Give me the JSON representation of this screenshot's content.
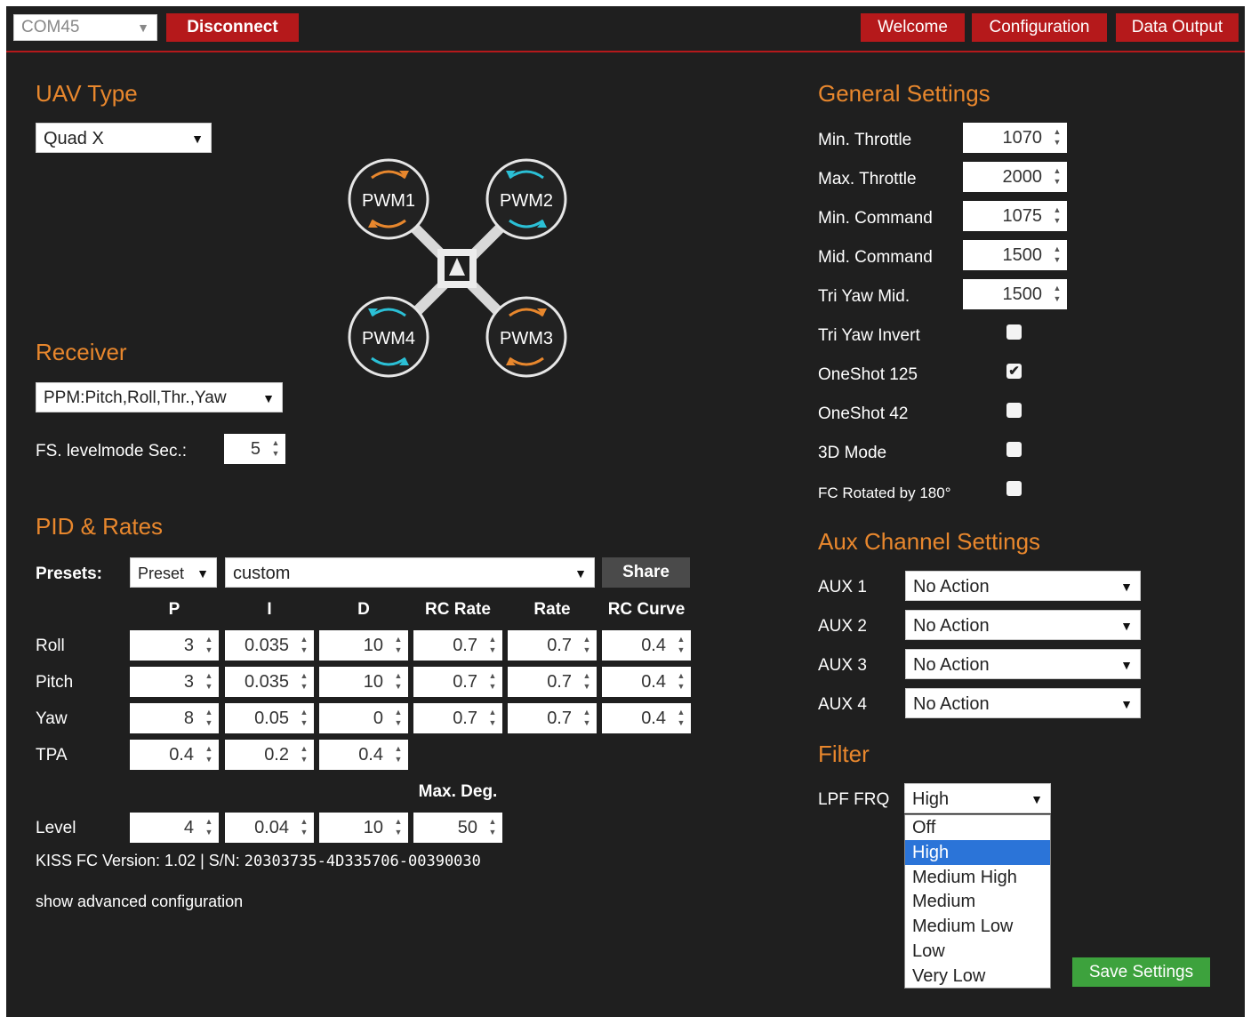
{
  "topbar": {
    "port": "COM45",
    "disconnect": "Disconnect",
    "tabs": [
      "Welcome",
      "Configuration",
      "Data Output"
    ]
  },
  "uav": {
    "title": "UAV Type",
    "type": "Quad X",
    "motors": [
      "PWM1",
      "PWM2",
      "PWM4",
      "PWM3"
    ]
  },
  "receiver": {
    "title": "Receiver",
    "type": "PPM:Pitch,Roll,Thr.,Yaw",
    "fs_label": "FS. levelmode Sec.:",
    "fs_value": "5"
  },
  "pid": {
    "title": "PID & Rates",
    "presets_label": "Presets:",
    "preset": "Preset",
    "preset_name": "custom",
    "share": "Share",
    "columns": [
      "P",
      "I",
      "D",
      "RC Rate",
      "Rate",
      "RC Curve"
    ],
    "rows": [
      {
        "name": "Roll",
        "values": [
          "3",
          "0.035",
          "10",
          "0.7",
          "0.7",
          "0.4"
        ]
      },
      {
        "name": "Pitch",
        "values": [
          "3",
          "0.035",
          "10",
          "0.7",
          "0.7",
          "0.4"
        ]
      },
      {
        "name": "Yaw",
        "values": [
          "8",
          "0.05",
          "0",
          "0.7",
          "0.7",
          "0.4"
        ]
      },
      {
        "name": "TPA",
        "values": [
          "0.4",
          "0.2",
          "0.4"
        ]
      }
    ],
    "maxdeg_label": "Max. Deg.",
    "level": {
      "name": "Level",
      "values": [
        "4",
        "0.04",
        "10",
        "50"
      ]
    }
  },
  "version": {
    "prefix": "KISS FC Version: 1.02 | S/N: ",
    "serial": "20303735-4D335706-00390030"
  },
  "advanced_link": "show advanced configuration",
  "general": {
    "title": "General Settings",
    "fields": [
      {
        "label": "Min. Throttle",
        "value": "1070"
      },
      {
        "label": "Max. Throttle",
        "value": "2000"
      },
      {
        "label": "Min. Command",
        "value": "1075"
      },
      {
        "label": "Mid. Command",
        "value": "1500"
      },
      {
        "label": "Tri Yaw Mid.",
        "value": "1500"
      }
    ],
    "checks": [
      {
        "label": "Tri Yaw Invert",
        "checked": false
      },
      {
        "label": "OneShot 125",
        "checked": true
      },
      {
        "label": "OneShot 42",
        "checked": false
      },
      {
        "label": "3D Mode",
        "checked": false
      },
      {
        "label": "FC Rotated by 180°",
        "checked": false
      }
    ]
  },
  "aux": {
    "title": "Aux Channel Settings",
    "channels": [
      {
        "label": "AUX 1",
        "value": "No Action"
      },
      {
        "label": "AUX 2",
        "value": "No Action"
      },
      {
        "label": "AUX 3",
        "value": "No Action"
      },
      {
        "label": "AUX 4",
        "value": "No Action"
      }
    ]
  },
  "filter": {
    "title": "Filter",
    "label": "LPF FRQ",
    "value": "High",
    "options": [
      "Off",
      "High",
      "Medium High",
      "Medium",
      "Medium Low",
      "Low",
      "Very Low"
    ]
  },
  "save": "Save Settings",
  "colors": {
    "accent": "#e8872d",
    "brand_red": "#b5191b",
    "save_green": "#3da23d",
    "background": "#1f1f1f",
    "arrow_orange": "#e8872d",
    "arrow_cyan": "#2bc0d6"
  }
}
